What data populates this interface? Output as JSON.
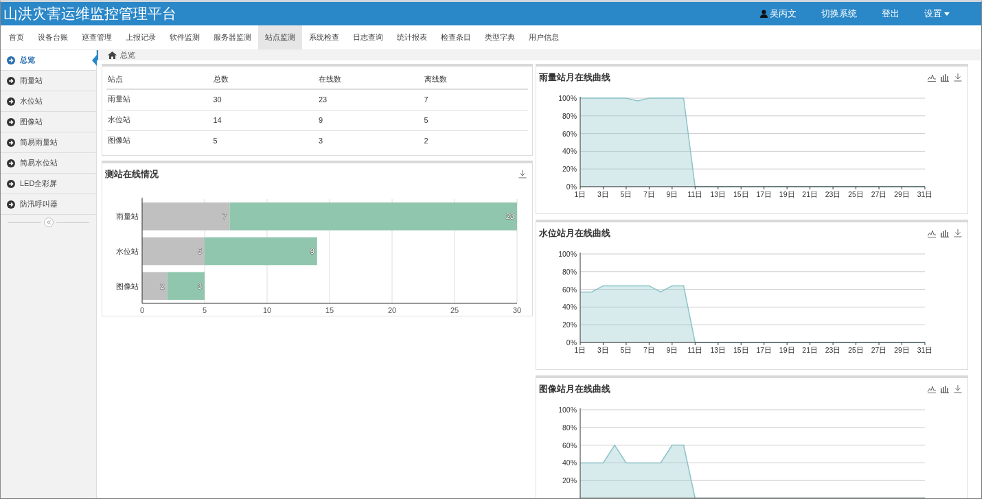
{
  "header": {
    "title": "山洪灾害运维监控管理平台",
    "user": "吴丙文",
    "links": [
      "切换系统",
      "登出"
    ],
    "settings": "设置"
  },
  "nav": [
    {
      "label": "首页",
      "selected": false
    },
    {
      "label": "设备台账",
      "selected": false
    },
    {
      "label": "巡查管理",
      "selected": false
    },
    {
      "label": "上报记录",
      "selected": false
    },
    {
      "label": "软件监测",
      "selected": false
    },
    {
      "label": "服务器监测",
      "selected": false
    },
    {
      "label": "站点监测",
      "selected": true
    },
    {
      "label": "系统检查",
      "selected": false
    },
    {
      "label": "日志查询",
      "selected": false
    },
    {
      "label": "统计报表",
      "selected": false
    },
    {
      "label": "检查条目",
      "selected": false
    },
    {
      "label": "类型字典",
      "selected": false
    },
    {
      "label": "用户信息",
      "selected": false
    }
  ],
  "sidebar": {
    "items": [
      {
        "label": "总览",
        "selected": true
      },
      {
        "label": "雨量站",
        "selected": false
      },
      {
        "label": "水位站",
        "selected": false
      },
      {
        "label": "图像站",
        "selected": false
      },
      {
        "label": "简易雨量站",
        "selected": false
      },
      {
        "label": "简易水位站",
        "selected": false
      },
      {
        "label": "LED全彩屏",
        "selected": false
      },
      {
        "label": "防汛呼叫器",
        "selected": false
      }
    ]
  },
  "breadcrumb": "总览",
  "table": {
    "columns": [
      "站点",
      "总数",
      "在线数",
      "离线数"
    ],
    "rows": [
      [
        "雨量站",
        "30",
        "23",
        "7"
      ],
      [
        "水位站",
        "14",
        "9",
        "5"
      ],
      [
        "图像站",
        "5",
        "3",
        "2"
      ]
    ]
  },
  "bar_panel": {
    "title": "测站在线情况",
    "chart_data": {
      "type": "bar",
      "orientation": "horizontal",
      "stacked": true,
      "grid": true,
      "data_labels": true,
      "categories": [
        "雨量站",
        "水位站",
        "图像站"
      ],
      "series": [
        {
          "color": "#c0c0c0",
          "values": [
            7,
            5,
            2
          ]
        },
        {
          "color": "#90c6ae",
          "values": [
            23,
            9,
            3
          ]
        }
      ],
      "xlim": [
        0,
        30
      ],
      "xticks": [
        0,
        5,
        10,
        15,
        20,
        25,
        30
      ]
    }
  },
  "line_panels": [
    {
      "title": "雨量站月在线曲线",
      "chart_data": {
        "type": "area",
        "grid": true,
        "x": [
          1,
          2,
          3,
          4,
          5,
          6,
          7,
          8,
          9,
          10,
          11,
          12,
          13,
          14,
          15,
          16,
          17,
          18,
          19,
          20,
          21,
          22,
          23,
          24,
          25,
          26,
          27,
          28,
          29,
          30,
          31
        ],
        "series": [
          {
            "color": "#8cc3c8",
            "values": [
              100,
              100,
              100,
              100,
              100,
              97,
              100,
              100,
              100,
              100,
              0,
              0,
              0,
              0,
              0,
              0,
              0,
              0,
              0,
              0,
              0,
              0,
              0,
              0,
              0,
              0,
              0,
              0,
              0,
              0,
              0
            ]
          }
        ],
        "xlim": [
          1,
          31
        ],
        "ylim": [
          0,
          100
        ],
        "yticks": [
          {
            "value": 0,
            "label": "0%"
          },
          {
            "value": 20,
            "label": "20%"
          },
          {
            "value": 40,
            "label": "40%"
          },
          {
            "value": 60,
            "label": "60%"
          },
          {
            "value": 80,
            "label": "80%"
          },
          {
            "value": 100,
            "label": "100%"
          }
        ],
        "xticks": [
          {
            "value": 1,
            "label": "1日"
          },
          {
            "value": 3,
            "label": "3日"
          },
          {
            "value": 5,
            "label": "5日"
          },
          {
            "value": 7,
            "label": "7日"
          },
          {
            "value": 9,
            "label": "9日"
          },
          {
            "value": 11,
            "label": "11日"
          },
          {
            "value": 13,
            "label": "13日"
          },
          {
            "value": 15,
            "label": "15日"
          },
          {
            "value": 17,
            "label": "17日"
          },
          {
            "value": 19,
            "label": "19日"
          },
          {
            "value": 21,
            "label": "21日"
          },
          {
            "value": 23,
            "label": "23日"
          },
          {
            "value": 25,
            "label": "25日"
          },
          {
            "value": 27,
            "label": "27日"
          },
          {
            "value": 29,
            "label": "29日"
          },
          {
            "value": 31,
            "label": "31日"
          }
        ]
      }
    },
    {
      "title": "水位站月在线曲线",
      "chart_data": {
        "type": "area",
        "grid": true,
        "x": [
          1,
          2,
          3,
          4,
          5,
          6,
          7,
          8,
          9,
          10,
          11,
          12,
          13,
          14,
          15,
          16,
          17,
          18,
          19,
          20,
          21,
          22,
          23,
          24,
          25,
          26,
          27,
          28,
          29,
          30,
          31
        ],
        "series": [
          {
            "color": "#8cc3c8",
            "values": [
              57,
              57,
              64,
              64,
              64,
              64,
              64,
              57,
              64,
              64,
              0,
              0,
              0,
              0,
              0,
              0,
              0,
              0,
              0,
              0,
              0,
              0,
              0,
              0,
              0,
              0,
              0,
              0,
              0,
              0,
              0
            ]
          }
        ],
        "xlim": [
          1,
          31
        ],
        "ylim": [
          0,
          100
        ],
        "yticks": [
          {
            "value": 0,
            "label": "0%"
          },
          {
            "value": 20,
            "label": "20%"
          },
          {
            "value": 40,
            "label": "40%"
          },
          {
            "value": 60,
            "label": "60%"
          },
          {
            "value": 80,
            "label": "80%"
          },
          {
            "value": 100,
            "label": "100%"
          }
        ],
        "xticks": [
          {
            "value": 1,
            "label": "1日"
          },
          {
            "value": 3,
            "label": "3日"
          },
          {
            "value": 5,
            "label": "5日"
          },
          {
            "value": 7,
            "label": "7日"
          },
          {
            "value": 9,
            "label": "9日"
          },
          {
            "value": 11,
            "label": "11日"
          },
          {
            "value": 13,
            "label": "13日"
          },
          {
            "value": 15,
            "label": "15日"
          },
          {
            "value": 17,
            "label": "17日"
          },
          {
            "value": 19,
            "label": "19日"
          },
          {
            "value": 21,
            "label": "21日"
          },
          {
            "value": 23,
            "label": "23日"
          },
          {
            "value": 25,
            "label": "25日"
          },
          {
            "value": 27,
            "label": "27日"
          },
          {
            "value": 29,
            "label": "29日"
          },
          {
            "value": 31,
            "label": "31日"
          }
        ]
      }
    },
    {
      "title": "图像站月在线曲线",
      "chart_data": {
        "type": "area",
        "grid": true,
        "series": [
          {
            "color": "#8cc3c8",
            "values": [
              40,
              40,
              40,
              60,
              40,
              40,
              40,
              40,
              60,
              60,
              0,
              0,
              0,
              0,
              0,
              0,
              0,
              0,
              0,
              0,
              0,
              0,
              0,
              0,
              0,
              0,
              0,
              0,
              0,
              0,
              0
            ]
          }
        ],
        "ylim": [
          0,
          100
        ],
        "yticks": [
          {
            "value": 20,
            "label": "20%"
          },
          {
            "value": 40,
            "label": "40%"
          },
          {
            "value": 60,
            "label": "60%"
          },
          {
            "value": 80,
            "label": "80%"
          },
          {
            "value": 100,
            "label": "100%"
          }
        ]
      }
    }
  ]
}
